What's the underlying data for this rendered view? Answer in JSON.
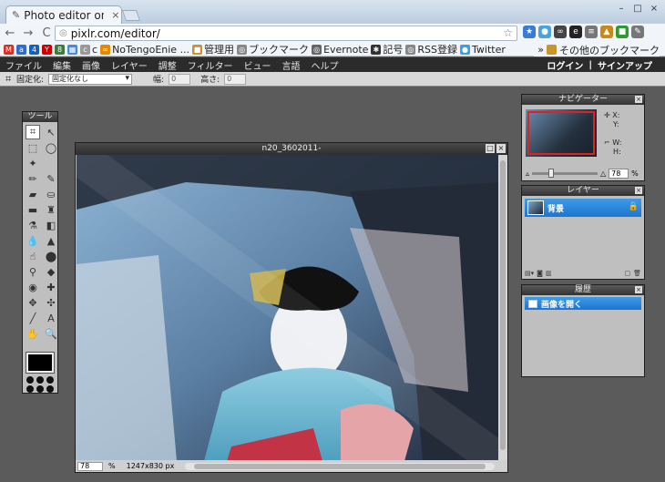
{
  "browser": {
    "tab_title": "Photo editor online",
    "tab_close": "×",
    "url": "pixlr.com/editor/",
    "win_buttons": [
      "–",
      "□",
      "×"
    ],
    "nav": [
      "←",
      "→",
      "C"
    ]
  },
  "extensions": [
    {
      "icon": "star-icon",
      "color": "#3a7bd5",
      "text": "★"
    },
    {
      "icon": "bird-icon",
      "color": "#4aa3df",
      "text": "●"
    },
    {
      "icon": "glasses-icon",
      "color": "#444",
      "text": "∞"
    },
    {
      "icon": "ew-icon",
      "color": "#222",
      "text": "e"
    },
    {
      "icon": "cal-icon",
      "color": "#777",
      "text": "≡"
    },
    {
      "icon": "chart-icon",
      "color": "#c78a1a",
      "text": "▲"
    },
    {
      "icon": "green-icon",
      "color": "#2e9a2e",
      "text": "■"
    },
    {
      "icon": "wrench-icon",
      "color": "#777",
      "text": "✎"
    }
  ],
  "bookmarks": [
    {
      "icon": "gmail-icon",
      "color": "#d93025",
      "text": "M",
      "label": ""
    },
    {
      "icon": "app-icon",
      "color": "#2d6bd6",
      "text": "a",
      "label": ""
    },
    {
      "icon": "four-icon",
      "color": "#1a5fb4",
      "text": "4",
      "label": ""
    },
    {
      "icon": "yahoo-icon",
      "color": "#c00",
      "text": "Y",
      "label": ""
    },
    {
      "icon": "gcal-icon",
      "color": "#3e7b3e",
      "text": "8",
      "label": ""
    },
    {
      "icon": "doc-icon",
      "color": "#4a8ad4",
      "text": "▦",
      "label": ""
    },
    {
      "icon": "c-icon",
      "color": "#999",
      "text": "c",
      "label": "c"
    },
    {
      "icon": "nte-icon",
      "color": "#e08a00",
      "text": "∞",
      "label": "NoTengoEnie ..."
    },
    {
      "icon": "folder-icon",
      "color": "#c7952d",
      "text": "■",
      "label": "管理用"
    },
    {
      "icon": "globe-icon",
      "color": "#888",
      "text": "◎",
      "label": "ブックマーク"
    },
    {
      "icon": "evernote-icon",
      "color": "#666",
      "text": "◎",
      "label": "Evernote"
    },
    {
      "icon": "arrow-icon",
      "color": "#333",
      "text": "✱",
      "label": "記号"
    },
    {
      "icon": "rss-icon",
      "color": "#888",
      "text": "◎",
      "label": "RSS登録"
    },
    {
      "icon": "twitter-icon",
      "color": "#3aa0e0",
      "text": "●",
      "label": "Twitter"
    }
  ],
  "bookmarks_more": "»",
  "bookmarks_other": "その他のブックマーク",
  "menu": {
    "items": [
      "ファイル",
      "編集",
      "画像",
      "レイヤー",
      "調整",
      "フィルター",
      "ビュー",
      "言語",
      "ヘルプ"
    ],
    "login": "ログイン",
    "sep": "|",
    "signup": "サインアップ"
  },
  "options": {
    "constraint_label": "固定化:",
    "constraint_value": "固定化なし",
    "width_label": "幅:",
    "width_value": "0",
    "height_label": "高さ:",
    "height_value": "0"
  },
  "tools_panel": {
    "title": "ツール",
    "tools": [
      {
        "name": "crop-tool-icon",
        "glyph": "⌗",
        "active": true
      },
      {
        "name": "move-tool-icon",
        "glyph": "↖",
        "active": false
      },
      {
        "name": "marquee-tool-icon",
        "glyph": "⬚",
        "active": false
      },
      {
        "name": "lasso-tool-icon",
        "glyph": "◯",
        "active": false
      },
      {
        "name": "wand-tool-icon",
        "glyph": "✦",
        "active": false
      },
      {
        "name": "blank-tool-icon",
        "glyph": "",
        "active": false
      },
      {
        "name": "pencil-tool-icon",
        "glyph": "✏",
        "active": false
      },
      {
        "name": "brush-tool-icon",
        "glyph": "✎",
        "active": false
      },
      {
        "name": "eraser-tool-icon",
        "glyph": "▰",
        "active": false
      },
      {
        "name": "bucket-tool-icon",
        "glyph": "⛀",
        "active": false
      },
      {
        "name": "gradient-tool-icon",
        "glyph": "▬",
        "active": false
      },
      {
        "name": "stamp-tool-icon",
        "glyph": "♜",
        "active": false
      },
      {
        "name": "picker-tool-icon",
        "glyph": "⚗",
        "active": false
      },
      {
        "name": "replace-tool-icon",
        "glyph": "◧",
        "active": false
      },
      {
        "name": "drop-tool-icon",
        "glyph": "💧",
        "active": false
      },
      {
        "name": "sharpen-tool-icon",
        "glyph": "▲",
        "active": false
      },
      {
        "name": "smudge-tool-icon",
        "glyph": "☝",
        "active": false
      },
      {
        "name": "sponge-tool-icon",
        "glyph": "⬤",
        "active": false
      },
      {
        "name": "burn-tool-icon",
        "glyph": "⚲",
        "active": false
      },
      {
        "name": "dodge-tool-icon",
        "glyph": "◆",
        "active": false
      },
      {
        "name": "redeye-tool-icon",
        "glyph": "◉",
        "active": false
      },
      {
        "name": "spot-tool-icon",
        "glyph": "✚",
        "active": false
      },
      {
        "name": "bloat-tool-icon",
        "glyph": "✥",
        "active": false
      },
      {
        "name": "pinch-tool-icon",
        "glyph": "✣",
        "active": false
      },
      {
        "name": "line-tool-icon",
        "glyph": "╱",
        "active": false
      },
      {
        "name": "text-tool-icon",
        "glyph": "A",
        "active": false
      },
      {
        "name": "hand-tool-icon",
        "glyph": "✋",
        "active": false
      },
      {
        "name": "zoom-tool-icon",
        "glyph": "🔍",
        "active": false
      }
    ]
  },
  "document": {
    "title": "n20_3602011-",
    "zoom": "78",
    "zoom_unit": "%",
    "size": "1247x830 px"
  },
  "navigator": {
    "title": "ナビゲーター",
    "x_label": "X:",
    "y_label": "Y:",
    "w_label": "W:",
    "h_label": "H:",
    "zoom": "78",
    "zoom_unit": "%",
    "zoom_fraction": 0.28
  },
  "layers": {
    "title": "レイヤー",
    "layer_name": "背景"
  },
  "history": {
    "title": "履歴",
    "item": "画像を開く"
  }
}
